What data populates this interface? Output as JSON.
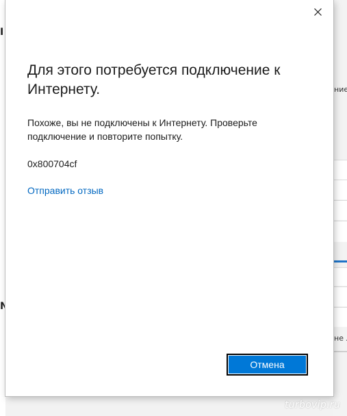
{
  "dialog": {
    "title": "Для этого потребуется подключение к Интернету.",
    "message": "Похоже, вы не подключены к Интернету. Проверьте подключение и повторите попытку.",
    "error_code": "0x800704cf",
    "feedback_link": "Отправить отзыв",
    "cancel_label": "Отмена",
    "close_icon": "close-icon"
  },
  "background": {
    "right_fragments": [
      "ние",
      "не л"
    ]
  },
  "watermark": "turbovip.ru",
  "colors": {
    "accent": "#0078d7",
    "link": "#0067c0",
    "dialog_bg": "#ffffff",
    "text": "#1b1b1b"
  }
}
